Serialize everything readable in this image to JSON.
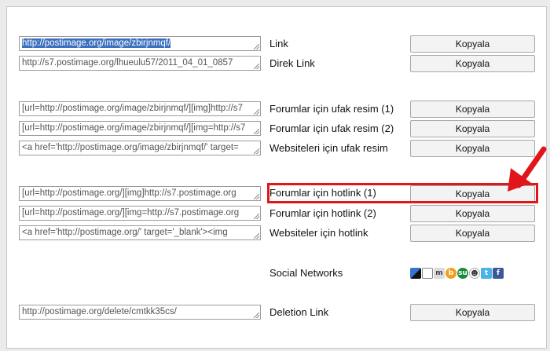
{
  "colors": {
    "highlight": "#e0161b",
    "arrow": "#e0161b"
  },
  "rows": [
    {
      "code": "http://postimage.org/image/zbirjnmqf/",
      "label": "Link",
      "button": "Kopyala"
    },
    {
      "code": "http://s7.postimage.org/lhueulu57/2011_04_01_0857",
      "label": "Direk Link",
      "button": "Kopyala"
    },
    {
      "code": "[url=http://postimage.org/image/zbirjnmqf/][img]http://s7",
      "label": "Forumlar için ufak resim (1)",
      "button": "Kopyala"
    },
    {
      "code": "[url=http://postimage.org/image/zbirjnmqf/][img=http://s7",
      "label": "Forumlar için ufak resim (2)",
      "button": "Kopyala"
    },
    {
      "code": "<a href='http://postimage.org/image/zbirjnmqf/' target=",
      "label": "Websiteleri için ufak resim",
      "button": "Kopyala"
    },
    {
      "code": "[url=http://postimage.org/][img]http://s7.postimage.org",
      "label": "Forumlar için hotlink (1)",
      "button": "Kopyala"
    },
    {
      "code": "[url=http://postimage.org/][img=http://s7.postimage.org",
      "label": "Forumlar için hotlink (2)",
      "button": "Kopyala"
    },
    {
      "code": "<a href='http://postimage.org/' target='_blank'><img",
      "label": "Websiteler için hotlink",
      "button": "Kopyala"
    }
  ],
  "social": {
    "label": "Social Networks",
    "icons": [
      "delicious-icon",
      "digg-icon",
      "myspace-icon",
      "google-buzz-icon",
      "stumbleupon-icon",
      "reddit-icon",
      "twitter-icon",
      "facebook-icon"
    ]
  },
  "deletion": {
    "code": "http://postimage.org/delete/cmtkk35cs/",
    "label": "Deletion Link",
    "button": "Kopyala"
  }
}
